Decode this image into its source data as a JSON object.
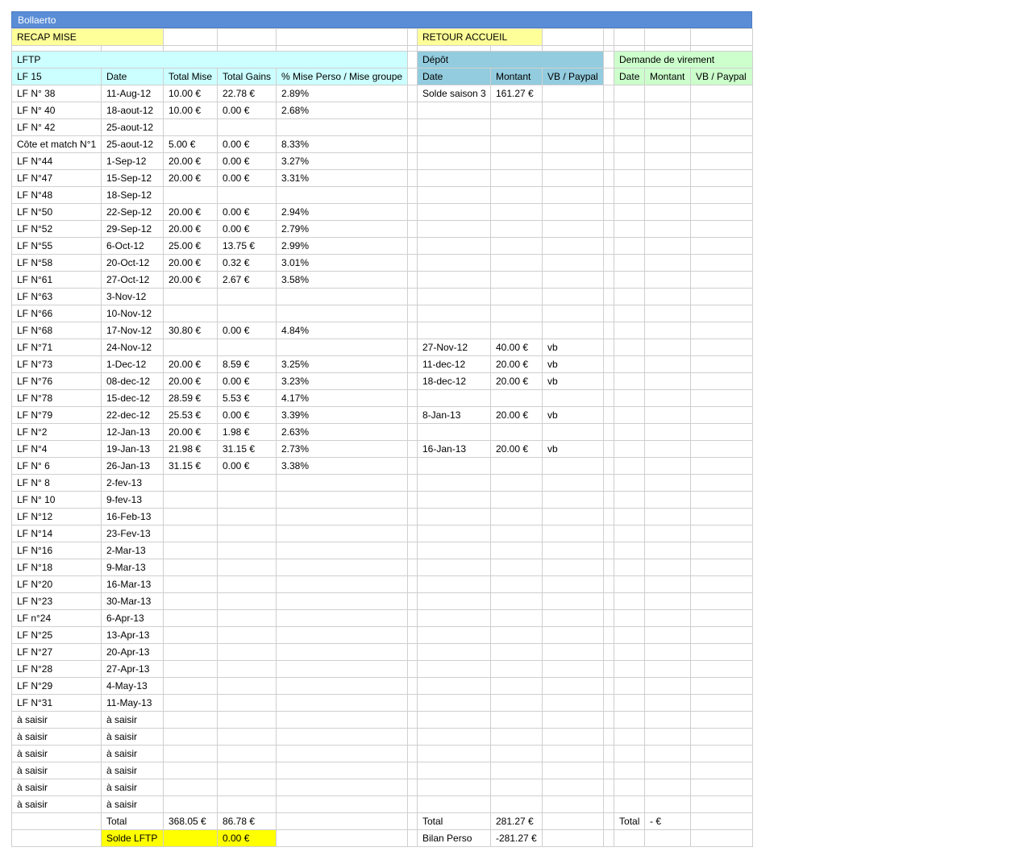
{
  "sheet_title": "Bollaerto",
  "links": {
    "recap": "RECAP MISE",
    "retour": "RETOUR ACCUEIL"
  },
  "sections": {
    "lftp": "LFTP",
    "depot": "Dépôt",
    "virement": "Demande de virement"
  },
  "headers": {
    "lf": [
      "LF 15",
      "Date",
      "Total Mise",
      "Total Gains",
      "% Mise Perso / Mise groupe"
    ],
    "depot": [
      "Date",
      "Montant",
      "VB / Paypal"
    ],
    "virement": [
      "Date",
      "Montant",
      "VB / Paypal"
    ]
  },
  "rows": [
    {
      "lf": [
        "LF N° 38",
        "11-Aug-12",
        "10.00 €",
        "22.78 €",
        "2.89%"
      ],
      "depot": [
        "Solde saison 3",
        "161.27 €",
        ""
      ]
    },
    {
      "lf": [
        "LF N° 40",
        "18-aout-12",
        "10.00 €",
        "0.00 €",
        "2.68%"
      ],
      "depot": [
        "",
        "",
        ""
      ]
    },
    {
      "lf": [
        "LF N° 42",
        "25-aout-12",
        "",
        "",
        ""
      ],
      "depot": [
        "",
        "",
        ""
      ]
    },
    {
      "lf": [
        "Côte et match N°1",
        "25-aout-12",
        "5.00 €",
        "0.00 €",
        "8.33%"
      ],
      "depot": [
        "",
        "",
        ""
      ]
    },
    {
      "lf": [
        "LF N°44",
        "1-Sep-12",
        "20.00 €",
        "0.00 €",
        "3.27%"
      ],
      "depot": [
        "",
        "",
        ""
      ]
    },
    {
      "lf": [
        "LF N°47",
        "15-Sep-12",
        "20.00 €",
        "0.00 €",
        "3.31%"
      ],
      "depot": [
        "",
        "",
        ""
      ]
    },
    {
      "lf": [
        "LF N°48",
        "18-Sep-12",
        "",
        "",
        ""
      ],
      "depot": [
        "",
        "",
        ""
      ]
    },
    {
      "lf": [
        "LF N°50",
        "22-Sep-12",
        "20.00 €",
        "0.00 €",
        "2.94%"
      ],
      "depot": [
        "",
        "",
        ""
      ]
    },
    {
      "lf": [
        "LF N°52",
        "29-Sep-12",
        "20.00 €",
        "0.00 €",
        "2.79%"
      ],
      "depot": [
        "",
        "",
        ""
      ]
    },
    {
      "lf": [
        "LF N°55",
        "6-Oct-12",
        "25.00 €",
        "13.75 €",
        "2.99%"
      ],
      "depot": [
        "",
        "",
        ""
      ]
    },
    {
      "lf": [
        "LF N°58",
        "20-Oct-12",
        "20.00 €",
        "0.32 €",
        "3.01%"
      ],
      "depot": [
        "",
        "",
        ""
      ]
    },
    {
      "lf": [
        "LF N°61",
        "27-Oct-12",
        "20.00 €",
        "2.67 €",
        "3.58%"
      ],
      "depot": [
        "",
        "",
        ""
      ]
    },
    {
      "lf": [
        "LF N°63",
        "3-Nov-12",
        "",
        "",
        ""
      ],
      "depot": [
        "",
        "",
        ""
      ]
    },
    {
      "lf": [
        "LF N°66",
        "10-Nov-12",
        "",
        "",
        ""
      ],
      "depot": [
        "",
        "",
        ""
      ]
    },
    {
      "lf": [
        "LF N°68",
        "17-Nov-12",
        "30.80 €",
        "0.00 €",
        "4.84%"
      ],
      "depot": [
        "",
        "",
        ""
      ]
    },
    {
      "lf": [
        "LF N°71",
        "24-Nov-12",
        "",
        "",
        ""
      ],
      "depot": [
        "27-Nov-12",
        "40.00 €",
        "vb"
      ]
    },
    {
      "lf": [
        "LF N°73",
        "1-Dec-12",
        "20.00 €",
        "8.59 €",
        "3.25%"
      ],
      "depot": [
        "11-dec-12",
        "20.00 €",
        "vb"
      ]
    },
    {
      "lf": [
        "LF N°76",
        "08-dec-12",
        "20.00 €",
        "0.00 €",
        "3.23%"
      ],
      "depot": [
        "18-dec-12",
        "20.00 €",
        "vb"
      ]
    },
    {
      "lf": [
        "LF N°78",
        "15-dec-12",
        "28.59 €",
        "5.53 €",
        "4.17%"
      ],
      "depot": [
        "",
        "",
        ""
      ]
    },
    {
      "lf": [
        "LF N°79",
        "22-dec-12",
        "25.53 €",
        "0.00 €",
        "3.39%"
      ],
      "depot": [
        "8-Jan-13",
        "20.00 €",
        "vb"
      ]
    },
    {
      "lf": [
        "LF N°2",
        "12-Jan-13",
        "20.00 €",
        "1.98 €",
        "2.63%"
      ],
      "depot": [
        "",
        "",
        ""
      ]
    },
    {
      "lf": [
        "LF N°4",
        "19-Jan-13",
        "21.98 €",
        "31.15 €",
        "2.73%"
      ],
      "depot": [
        "16-Jan-13",
        "20.00 €",
        "vb"
      ]
    },
    {
      "lf": [
        "LF N° 6",
        "26-Jan-13",
        "31.15 €",
        "0.00 €",
        "3.38%"
      ],
      "depot": [
        "",
        "",
        ""
      ]
    },
    {
      "lf": [
        "LF N° 8",
        "2-fev-13",
        "",
        "",
        ""
      ],
      "depot": [
        "",
        "",
        ""
      ]
    },
    {
      "lf": [
        "LF N° 10",
        "9-fev-13",
        "",
        "",
        ""
      ],
      "depot": [
        "",
        "",
        ""
      ]
    },
    {
      "lf": [
        "LF N°12",
        "16-Feb-13",
        "",
        "",
        ""
      ],
      "depot": [
        "",
        "",
        ""
      ]
    },
    {
      "lf": [
        "LF N°14",
        "23-Fev-13",
        "",
        "",
        ""
      ],
      "depot": [
        "",
        "",
        ""
      ]
    },
    {
      "lf": [
        "LF N°16",
        "2-Mar-13",
        "",
        "",
        ""
      ],
      "depot": [
        "",
        "",
        ""
      ]
    },
    {
      "lf": [
        "LF N°18",
        "9-Mar-13",
        "",
        "",
        ""
      ],
      "depot": [
        "",
        "",
        ""
      ]
    },
    {
      "lf": [
        "LF N°20",
        "16-Mar-13",
        "",
        "",
        ""
      ],
      "depot": [
        "",
        "",
        ""
      ]
    },
    {
      "lf": [
        "LF N°23",
        "30-Mar-13",
        "",
        "",
        ""
      ],
      "depot": [
        "",
        "",
        ""
      ]
    },
    {
      "lf": [
        "LF n°24",
        "6-Apr-13",
        "",
        "",
        ""
      ],
      "depot": [
        "",
        "",
        ""
      ]
    },
    {
      "lf": [
        "LF N°25",
        "13-Apr-13",
        "",
        "",
        ""
      ],
      "depot": [
        "",
        "",
        ""
      ]
    },
    {
      "lf": [
        "LF N°27",
        "20-Apr-13",
        "",
        "",
        ""
      ],
      "depot": [
        "",
        "",
        ""
      ]
    },
    {
      "lf": [
        "LF N°28",
        "27-Apr-13",
        "",
        "",
        ""
      ],
      "depot": [
        "",
        "",
        ""
      ]
    },
    {
      "lf": [
        "LF N°29",
        "4-May-13",
        "",
        "",
        ""
      ],
      "depot": [
        "",
        "",
        ""
      ]
    },
    {
      "lf": [
        "LF N°31",
        "11-May-13",
        "",
        "",
        ""
      ],
      "depot": [
        "",
        "",
        ""
      ]
    },
    {
      "lf": [
        "à saisir",
        "à saisir",
        "",
        "",
        ""
      ],
      "depot": [
        "",
        "",
        ""
      ]
    },
    {
      "lf": [
        "à saisir",
        "à saisir",
        "",
        "",
        ""
      ],
      "depot": [
        "",
        "",
        ""
      ]
    },
    {
      "lf": [
        "à saisir",
        "à saisir",
        "",
        "",
        ""
      ],
      "depot": [
        "",
        "",
        ""
      ]
    },
    {
      "lf": [
        "à saisir",
        "à saisir",
        "",
        "",
        ""
      ],
      "depot": [
        "",
        "",
        ""
      ]
    },
    {
      "lf": [
        "à saisir",
        "à saisir",
        "",
        "",
        ""
      ],
      "depot": [
        "",
        "",
        ""
      ]
    },
    {
      "lf": [
        "à saisir",
        "à saisir",
        "",
        "",
        ""
      ],
      "depot": [
        "",
        "",
        ""
      ]
    }
  ],
  "totals": {
    "label": "Total",
    "total_mise": "368.05 €",
    "total_gains": "86.78 €",
    "depot_label": "Total",
    "depot_total": "281.27 €",
    "virement_label": "Total",
    "virement_total": "- €"
  },
  "solde": {
    "label": "Solde LFTP",
    "value": "0.00 €",
    "bilan_label": "Bilan Perso",
    "bilan_value": "-281.27 €"
  },
  "colors": {
    "title_bar": "#5a8dd6",
    "link_yellow": "#ffff99",
    "lftp_cyan": "#ccffff",
    "depot_header": "#93ccde",
    "virement_green": "#ccffcc",
    "solde_yellow": "#ffff00"
  }
}
